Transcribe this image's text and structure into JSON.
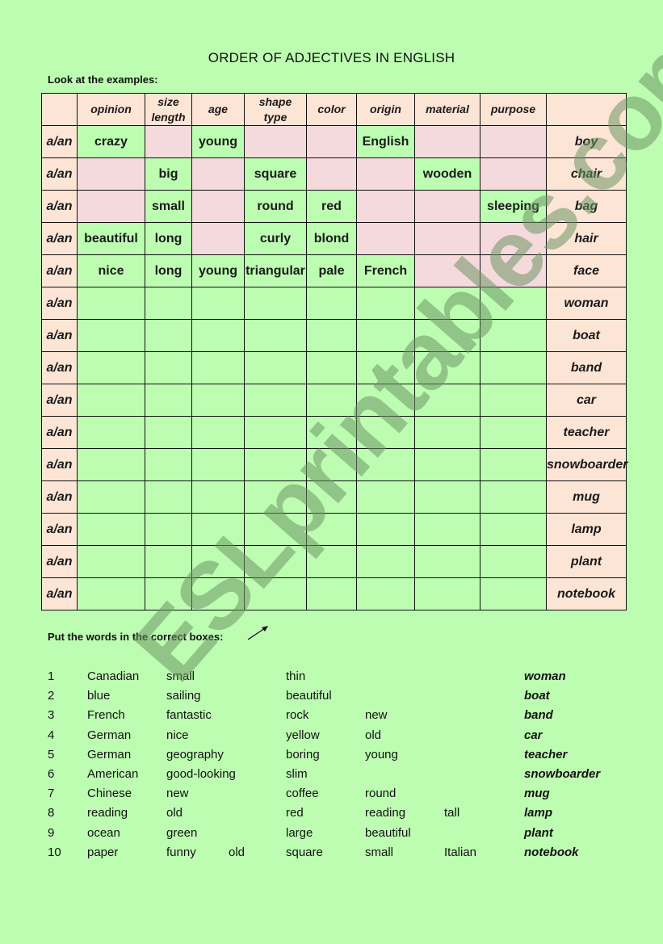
{
  "title": "ORDER OF ADJECTIVES IN ENGLISH",
  "instruction_examples": "Look at the examples:",
  "table": {
    "headers": [
      "",
      "opinion",
      "size\nlength",
      "age",
      "shape\ntype",
      "color",
      "origin",
      "material",
      "purpose",
      ""
    ],
    "header_lines": [
      [
        ""
      ],
      [
        "opinion"
      ],
      [
        "size",
        "length"
      ],
      [
        "age"
      ],
      [
        "shape",
        "type"
      ],
      [
        "color"
      ],
      [
        "origin"
      ],
      [
        "material"
      ],
      [
        "purpose"
      ],
      [
        ""
      ]
    ],
    "article": "a/an",
    "example_rows": [
      {
        "cells": [
          "crazy",
          "",
          "young",
          "",
          "",
          "English",
          "",
          ""
        ],
        "noun": "boy"
      },
      {
        "cells": [
          "",
          "big",
          "",
          "square",
          "",
          "",
          "wooden",
          ""
        ],
        "noun": "chair"
      },
      {
        "cells": [
          "",
          "small",
          "",
          "round",
          "red",
          "",
          "",
          "sleeping"
        ],
        "noun": "bag"
      },
      {
        "cells": [
          "beautiful",
          "long",
          "",
          "curly",
          "blond",
          "",
          "",
          ""
        ],
        "noun": "hair"
      },
      {
        "cells": [
          "nice",
          "long",
          "young",
          "triangular",
          "pale",
          "French",
          "",
          ""
        ],
        "noun": "face"
      }
    ],
    "exercise_nouns": [
      "woman",
      "boat",
      "band",
      "car",
      "teacher",
      "snowboarder",
      "mug",
      "lamp",
      "plant",
      "notebook"
    ]
  },
  "instruction_words": "Put the words in the correct boxes:",
  "arrow_icon": "arrow-up-right",
  "word_list": [
    {
      "num": "1",
      "c1": "Canadian",
      "c2": "small",
      "c2b": "",
      "c3": "thin",
      "c4": "",
      "c5": "",
      "noun": "woman"
    },
    {
      "num": "2",
      "c1": "blue",
      "c2": "sailing",
      "c2b": "",
      "c3": "beautiful",
      "c4": "",
      "c5": "",
      "noun": "boat"
    },
    {
      "num": "3",
      "c1": "French",
      "c2": "fantastic",
      "c2b": "",
      "c3": "rock",
      "c4": "new",
      "c5": "",
      "noun": "band"
    },
    {
      "num": "4",
      "c1": "German",
      "c2": "nice",
      "c2b": "",
      "c3": "yellow",
      "c4": "old",
      "c5": "",
      "noun": "car"
    },
    {
      "num": "5",
      "c1": "German",
      "c2": "geography",
      "c2b": "",
      "c3": "boring",
      "c4": "young",
      "c5": "",
      "noun": "teacher"
    },
    {
      "num": "6",
      "c1": "American",
      "c2": "good-looking",
      "c2b": "",
      "c3": "slim",
      "c4": "",
      "c5": "",
      "noun": "snowboarder"
    },
    {
      "num": "7",
      "c1": "Chinese",
      "c2": "new",
      "c2b": "",
      "c3": "coffee",
      "c4": "round",
      "c5": "",
      "noun": "mug"
    },
    {
      "num": "8",
      "c1": "reading",
      "c2": "old",
      "c2b": "",
      "c3": "red",
      "c4": "reading",
      "c5": "tall",
      "noun": "lamp"
    },
    {
      "num": "9",
      "c1": "ocean",
      "c2": "green",
      "c2b": "",
      "c3": "large",
      "c4": "beautiful",
      "c5": "",
      "noun": "plant"
    },
    {
      "num": "10",
      "c1": "paper",
      "c2": "funny",
      "c2b": "old",
      "c3": "square",
      "c4": "small",
      "c5": "Italian",
      "noun": "notebook"
    }
  ],
  "watermark": "ESLprintables.com",
  "colors": {
    "page_bg": "#bdfdb2",
    "header_bg": "#fde5d6",
    "empty_example_cell": "#f5dadd",
    "watermark": "#6e9664"
  }
}
